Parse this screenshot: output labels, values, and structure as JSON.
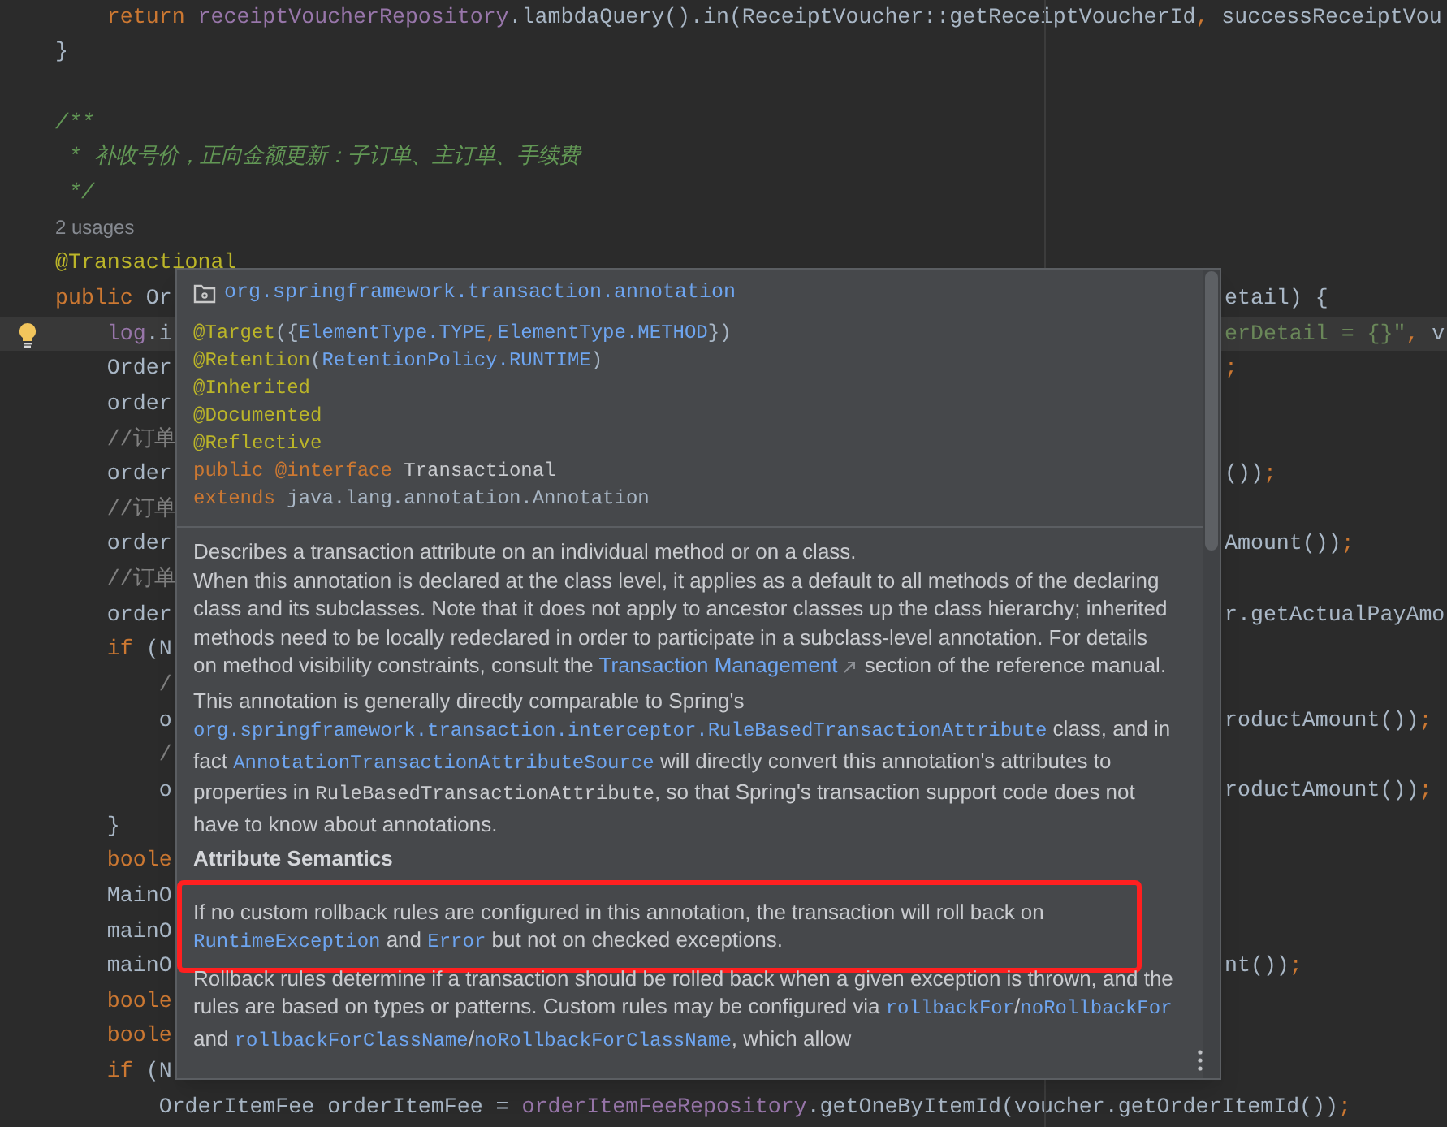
{
  "editor": {
    "lines": [
      {
        "current": false,
        "intention_bulb": false,
        "left": [
          {
            "text": "    return",
            "kind": "keyword"
          },
          {
            "text": " receiptVoucherRepository",
            "kind": "field"
          },
          {
            "text": ".lambdaQuery().in(ReceiptVoucher::getReceiptVoucherId",
            "kind": "plain"
          },
          {
            "text": ",",
            "kind": "keyword"
          },
          {
            "text": " successReceiptVou",
            "kind": "plain"
          }
        ]
      },
      {
        "current": false,
        "intention_bulb": false,
        "left": [
          {
            "text": "}",
            "kind": "plain"
          }
        ]
      },
      {
        "current": false,
        "intention_bulb": false
      },
      {
        "current": false,
        "intention_bulb": false,
        "left": [
          {
            "text": "/**",
            "kind": "doc"
          }
        ]
      },
      {
        "current": false,
        "intention_bulb": false,
        "left": [
          {
            "text": " * 补收号价，正向金额更新：子订单、主订单、手续费",
            "kind": "doc"
          }
        ]
      },
      {
        "current": false,
        "intention_bulb": false,
        "left": [
          {
            "text": " */",
            "kind": "doc"
          }
        ]
      },
      {
        "current": false,
        "intention_bulb": false,
        "left": [
          {
            "text": "2 usages",
            "kind": "usages"
          }
        ]
      },
      {
        "current": false,
        "intention_bulb": false,
        "left": [
          {
            "text": "@Transactional",
            "kind": "annotation"
          }
        ]
      },
      {
        "current": false,
        "intention_bulb": false,
        "left": [
          {
            "text": "public",
            "kind": "keyword"
          },
          {
            "text": " Or",
            "kind": "plain"
          }
        ],
        "right": [
          {
            "text": "etail) {",
            "kind": "plain"
          }
        ]
      },
      {
        "current": true,
        "intention_bulb": true,
        "left": [
          {
            "text": "    log",
            "kind": "field"
          },
          {
            "text": ".i",
            "kind": "plain"
          }
        ],
        "right": [
          {
            "text": "erDetail = {}\"",
            "kind": "string"
          },
          {
            "text": ",",
            "kind": "keyword"
          },
          {
            "text": " v",
            "kind": "plain"
          }
        ]
      },
      {
        "current": false,
        "intention_bulb": false,
        "left": [
          {
            "text": "    Order",
            "kind": "plain"
          }
        ],
        "right": [
          {
            "text": ";",
            "kind": "keyword"
          }
        ]
      },
      {
        "current": false,
        "intention_bulb": false,
        "left": [
          {
            "text": "    order",
            "kind": "plain"
          }
        ]
      },
      {
        "current": false,
        "intention_bulb": false,
        "left": [
          {
            "text": "    //订单",
            "kind": "comment"
          }
        ]
      },
      {
        "current": false,
        "intention_bulb": false,
        "left": [
          {
            "text": "    order",
            "kind": "plain"
          }
        ],
        "right": [
          {
            "text": "())",
            "kind": "plain"
          },
          {
            "text": ";",
            "kind": "keyword"
          }
        ]
      },
      {
        "current": false,
        "intention_bulb": false,
        "left": [
          {
            "text": "    //订单",
            "kind": "comment"
          }
        ]
      },
      {
        "current": false,
        "intention_bulb": false,
        "left": [
          {
            "text": "    order",
            "kind": "plain"
          }
        ],
        "right": [
          {
            "text": "Amount())",
            "kind": "plain"
          },
          {
            "text": ";",
            "kind": "keyword"
          }
        ]
      },
      {
        "current": false,
        "intention_bulb": false,
        "left": [
          {
            "text": "    //订单",
            "kind": "comment"
          }
        ]
      },
      {
        "current": false,
        "intention_bulb": false,
        "left": [
          {
            "text": "    order",
            "kind": "plain"
          }
        ],
        "right": [
          {
            "text": "r.getActualPayAmo",
            "kind": "plain"
          }
        ]
      },
      {
        "current": false,
        "intention_bulb": false,
        "left": [
          {
            "text": "    if",
            "kind": "keyword"
          },
          {
            "text": " (N",
            "kind": "plain"
          }
        ]
      },
      {
        "current": false,
        "intention_bulb": false,
        "left": [
          {
            "text": "        /",
            "kind": "comment"
          }
        ]
      },
      {
        "current": false,
        "intention_bulb": false,
        "left": [
          {
            "text": "        o",
            "kind": "plain"
          }
        ],
        "right": [
          {
            "text": "roductAmount())",
            "kind": "plain"
          },
          {
            "text": ";",
            "kind": "keyword"
          }
        ]
      },
      {
        "current": false,
        "intention_bulb": false,
        "left": [
          {
            "text": "        /",
            "kind": "comment"
          }
        ]
      },
      {
        "current": false,
        "intention_bulb": false,
        "left": [
          {
            "text": "        o",
            "kind": "plain"
          }
        ],
        "right": [
          {
            "text": "roductAmount())",
            "kind": "plain"
          },
          {
            "text": ";",
            "kind": "keyword"
          }
        ]
      },
      {
        "current": false,
        "intention_bulb": false,
        "left": [
          {
            "text": "    }",
            "kind": "plain"
          }
        ]
      },
      {
        "current": false,
        "intention_bulb": false,
        "left": [
          {
            "text": "    boole",
            "kind": "keyword"
          }
        ]
      },
      {
        "current": false,
        "intention_bulb": false,
        "left": [
          {
            "text": "    MainO",
            "kind": "plain"
          }
        ]
      },
      {
        "current": false,
        "intention_bulb": false,
        "left": [
          {
            "text": "    mainO",
            "kind": "plain"
          }
        ]
      },
      {
        "current": false,
        "intention_bulb": false,
        "left": [
          {
            "text": "    mainO",
            "kind": "plain"
          }
        ],
        "right": [
          {
            "text": "nt())",
            "kind": "plain"
          },
          {
            "text": ";",
            "kind": "keyword"
          }
        ]
      },
      {
        "current": false,
        "intention_bulb": false,
        "left": [
          {
            "text": "    boole",
            "kind": "keyword"
          }
        ]
      },
      {
        "current": false,
        "intention_bulb": false,
        "left": [
          {
            "text": "    boole",
            "kind": "keyword"
          }
        ]
      },
      {
        "current": false,
        "intention_bulb": false,
        "left": [
          {
            "text": "    if",
            "kind": "keyword"
          },
          {
            "text": " (N",
            "kind": "plain"
          }
        ]
      },
      {
        "current": false,
        "intention_bulb": false,
        "left": [
          {
            "text": "        OrderItemFee orderItemFee = ",
            "kind": "plain"
          },
          {
            "text": "orderItemFeeRepository",
            "kind": "field"
          },
          {
            "text": ".getOneByItemId(voucher.getOrderItemId())",
            "kind": "plain"
          },
          {
            "text": ";",
            "kind": "keyword"
          }
        ]
      }
    ]
  },
  "doc_popup": {
    "package": "org.springframework.transaction.annotation",
    "signature": [
      [
        {
          "text": "@Target",
          "kind": "annotation"
        },
        {
          "text": "({",
          "kind": "plain"
        },
        {
          "text": "ElementType.TYPE",
          "kind": "link"
        },
        {
          "text": ",",
          "kind": "keyword"
        },
        {
          "text": "ElementType.METHOD",
          "kind": "link"
        },
        {
          "text": "})",
          "kind": "plain"
        }
      ],
      [
        {
          "text": "@Retention",
          "kind": "annotation"
        },
        {
          "text": "(",
          "kind": "plain"
        },
        {
          "text": "RetentionPolicy.RUNTIME",
          "kind": "link"
        },
        {
          "text": ")",
          "kind": "plain"
        }
      ],
      [
        {
          "text": "@Inherited",
          "kind": "annotation"
        }
      ],
      [
        {
          "text": "@Documented",
          "kind": "annotation"
        }
      ],
      [
        {
          "text": "@Reflective",
          "kind": "annotation"
        }
      ],
      [
        {
          "text": "public",
          "kind": "keyword"
        },
        {
          "text": " @interface",
          "kind": "keyword"
        },
        {
          "text": " Transactional",
          "kind": "name"
        }
      ],
      [
        {
          "text": "extends",
          "kind": "keyword"
        },
        {
          "text": " java.lang.annotation.Annotation",
          "kind": "plain"
        }
      ]
    ],
    "blocks": [
      {
        "kind": "paragraph",
        "highlighted": false,
        "segments": [
          {
            "text": "Describes a transaction attribute on an individual method or on a class.",
            "kind": "text"
          }
        ]
      },
      {
        "kind": "paragraph",
        "highlighted": false,
        "segments": [
          {
            "text": "When this annotation is declared at the class level, it applies as a default to all methods of the declaring class and its subclasses. Note that it does not apply to ancestor classes up the class hierarchy; inherited methods need to be locally redeclared in order to participate in a subclass-level annotation. For details on method visibility constraints, consult the ",
            "kind": "text"
          },
          {
            "text": "Transaction Management",
            "kind": "external_link"
          },
          {
            "text": " section of the reference manual.",
            "kind": "text"
          }
        ]
      },
      {
        "kind": "paragraph",
        "highlighted": false,
        "segments": [
          {
            "text": "This annotation is generally directly comparable to Spring's ",
            "kind": "text"
          },
          {
            "text": "org.springframework.transaction.interceptor.RuleBasedTransactionAttribute",
            "kind": "code_link"
          },
          {
            "text": " class, and in fact ",
            "kind": "text"
          },
          {
            "text": "AnnotationTransactionAttributeSource",
            "kind": "code_link"
          },
          {
            "text": " will directly convert this annotation's attributes to properties in ",
            "kind": "text"
          },
          {
            "text": "RuleBasedTransactionAttribute",
            "kind": "code"
          },
          {
            "text": ", so that Spring's transaction support code does not have to know about annotations.",
            "kind": "text"
          }
        ]
      },
      {
        "kind": "heading",
        "text": "Attribute Semantics"
      },
      {
        "kind": "paragraph",
        "highlighted": true,
        "segments": [
          {
            "text": "If no custom rollback rules are configured in this annotation, the transaction will roll back on ",
            "kind": "text"
          },
          {
            "text": "RuntimeException",
            "kind": "code_link"
          },
          {
            "text": " and ",
            "kind": "text"
          },
          {
            "text": "Error",
            "kind": "code_link"
          },
          {
            "text": " but not on checked exceptions.",
            "kind": "text"
          }
        ]
      },
      {
        "kind": "paragraph",
        "highlighted": false,
        "segments": [
          {
            "text": "Rollback rules determine if a transaction should be rolled back when a given exception is thrown, and the rules are based on types or patterns. Custom rules may be configured via ",
            "kind": "text"
          },
          {
            "text": "rollbackFor",
            "kind": "code_link"
          },
          {
            "text": "/",
            "kind": "text"
          },
          {
            "text": "noRollbackFor",
            "kind": "code_link"
          },
          {
            "text": " and ",
            "kind": "text"
          },
          {
            "text": "rollbackForClassName",
            "kind": "code_link"
          },
          {
            "text": "/",
            "kind": "text"
          },
          {
            "text": "noRollbackForClassName",
            "kind": "code_link"
          },
          {
            "text": ", which allow",
            "kind": "text"
          }
        ]
      }
    ]
  }
}
